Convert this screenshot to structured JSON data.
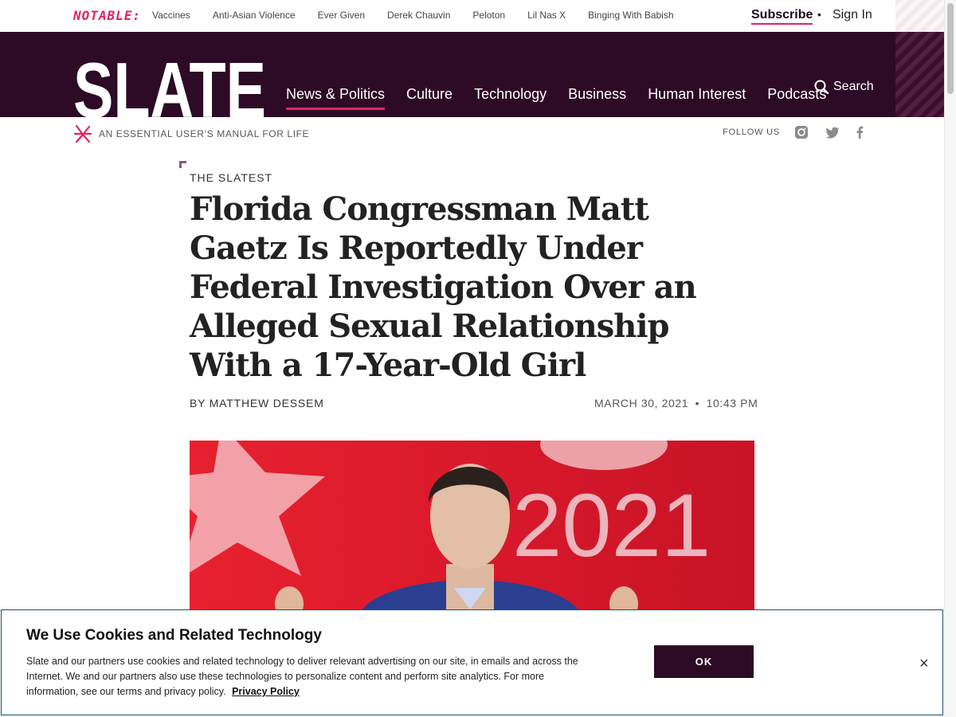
{
  "notable": {
    "label": "NOTABLE:",
    "links": [
      "Vaccines",
      "Anti-Asian Violence",
      "Ever Given",
      "Derek Chauvin",
      "Peloton",
      "Lil Nas X",
      "Binging With Babish"
    ]
  },
  "account": {
    "subscribe": "Subscribe",
    "separator": "•",
    "sign_in": "Sign In"
  },
  "header": {
    "logo_text": "SLATE",
    "search_label": "Search",
    "nav": [
      {
        "label": "News & Politics",
        "active": true
      },
      {
        "label": "Culture"
      },
      {
        "label": "Technology"
      },
      {
        "label": "Business"
      },
      {
        "label": "Human Interest"
      },
      {
        "label": "Podcasts"
      }
    ]
  },
  "tagline": "AN ESSENTIAL USER’S MANUAL FOR LIFE",
  "follow": {
    "label": "FOLLOW US",
    "icons": [
      "instagram-icon",
      "twitter-icon",
      "facebook-icon"
    ]
  },
  "article": {
    "kicker": "THE SLATEST",
    "headline": "Florida Congressman Matt Gaetz Is Reportedly Under Federal Investigation Over an Alleged Sexual Relationship With a 17-Year-Old Girl",
    "byline": "BY MATTHEW DESSEM",
    "date": "MARCH 30, 2021",
    "date_separator": "•",
    "time": "10:43 PM",
    "photo_text": "2021"
  },
  "cookie": {
    "title": "We Use Cookies and Related Technology",
    "body": "Slate and our partners use cookies and related technology to deliver relevant advertising on our site, in emails and across the Internet. We and our partners also use these technologies to personalize content and perform site analytics. For more information, see our terms and privacy policy.",
    "link": "Privacy Policy",
    "ok": "OK",
    "close": "×"
  },
  "colors": {
    "brand_dark": "#2d0a25",
    "accent": "#e0245e",
    "photo_red": "#d9192a"
  }
}
